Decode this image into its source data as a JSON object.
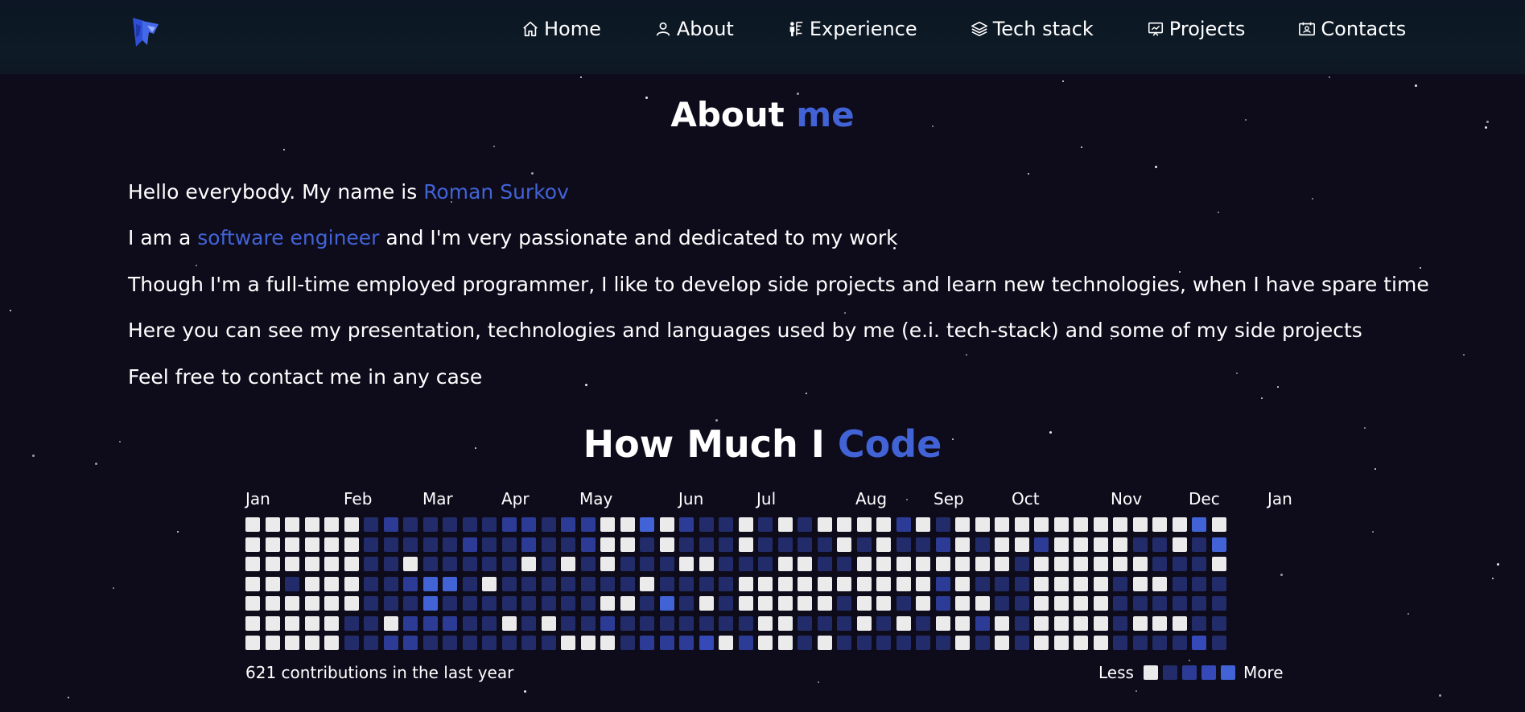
{
  "nav": {
    "items": [
      {
        "label": "Home",
        "icon": "home-icon"
      },
      {
        "label": "About",
        "icon": "user-icon"
      },
      {
        "label": "Experience",
        "icon": "presenter-icon"
      },
      {
        "label": "Tech stack",
        "icon": "layers-icon"
      },
      {
        "label": "Projects",
        "icon": "presentation-board-icon"
      },
      {
        "label": "Contacts",
        "icon": "contact-card-icon"
      }
    ]
  },
  "about": {
    "title_plain": "About ",
    "title_accent": "me",
    "line1_pre": "Hello everybody. My name is ",
    "line1_name": "Roman Surkov",
    "line2_pre": "I am a ",
    "line2_role": "software engineer",
    "line2_post": " and I'm very passionate and dedicated to my work",
    "line3": "Though I'm a full-time employed programmer, I like to develop side projects and learn new technologies, when I have spare time",
    "line4": "Here you can see my presentation, technologies and languages used by me (e.i. tech-stack) and some of my side projects",
    "line5": "Feel free to contact me in any case"
  },
  "code": {
    "title_plain": "How Much I ",
    "title_accent": "Code",
    "total_text": "621 contributions in the last year",
    "legend_less": "Less",
    "legend_more": "More",
    "months": [
      "Jan",
      "Feb",
      "Mar",
      "Apr",
      "May",
      "Jun",
      "Jul",
      "Aug",
      "Sep",
      "Oct",
      "Nov",
      "Dec",
      "Jan"
    ],
    "level_colors": [
      "#ebebeb",
      "#222c6a",
      "#2c3c96",
      "#3549b8",
      "#4263d6"
    ],
    "weeks": [
      [
        0,
        0,
        0,
        0,
        0,
        0,
        0
      ],
      [
        0,
        0,
        0,
        0,
        0,
        0,
        0
      ],
      [
        0,
        0,
        0,
        1,
        0,
        0,
        0
      ],
      [
        0,
        0,
        0,
        0,
        0,
        0,
        0
      ],
      [
        0,
        0,
        0,
        0,
        0,
        0,
        0
      ],
      [
        0,
        0,
        0,
        0,
        0,
        1,
        1
      ],
      [
        1,
        1,
        1,
        1,
        1,
        1,
        1
      ],
      [
        2,
        1,
        1,
        1,
        1,
        0,
        2
      ],
      [
        1,
        1,
        0,
        2,
        1,
        2,
        2
      ],
      [
        1,
        1,
        1,
        4,
        4,
        2,
        1
      ],
      [
        1,
        1,
        1,
        4,
        1,
        2,
        1
      ],
      [
        1,
        2,
        1,
        1,
        1,
        1,
        1
      ],
      [
        1,
        1,
        1,
        0,
        1,
        1,
        1
      ],
      [
        2,
        1,
        1,
        1,
        1,
        0,
        1
      ],
      [
        2,
        2,
        0,
        1,
        1,
        1,
        1
      ],
      [
        1,
        1,
        1,
        1,
        1,
        0,
        1
      ],
      [
        2,
        1,
        0,
        1,
        1,
        1,
        0
      ],
      [
        2,
        2,
        1,
        1,
        1,
        1,
        0
      ],
      [
        0,
        0,
        0,
        1,
        0,
        2,
        0
      ],
      [
        0,
        0,
        1,
        1,
        0,
        1,
        1
      ],
      [
        4,
        1,
        1,
        0,
        1,
        1,
        2
      ],
      [
        0,
        0,
        1,
        1,
        4,
        1,
        2
      ],
      [
        2,
        1,
        0,
        1,
        1,
        1,
        2
      ],
      [
        1,
        1,
        0,
        1,
        0,
        1,
        3
      ],
      [
        1,
        1,
        1,
        1,
        1,
        1,
        0
      ],
      [
        0,
        0,
        1,
        0,
        0,
        1,
        2
      ],
      [
        1,
        1,
        1,
        0,
        0,
        0,
        0
      ],
      [
        0,
        1,
        0,
        0,
        0,
        0,
        0
      ],
      [
        1,
        1,
        0,
        0,
        0,
        1,
        1
      ],
      [
        0,
        1,
        1,
        0,
        0,
        1,
        0
      ],
      [
        0,
        0,
        1,
        0,
        1,
        1,
        1
      ],
      [
        0,
        1,
        0,
        0,
        0,
        0,
        1
      ],
      [
        0,
        0,
        0,
        0,
        0,
        1,
        1
      ],
      [
        2,
        1,
        0,
        0,
        1,
        0,
        1
      ],
      [
        0,
        1,
        0,
        0,
        0,
        1,
        1
      ],
      [
        1,
        2,
        0,
        2,
        2,
        0,
        1
      ],
      [
        0,
        0,
        0,
        0,
        0,
        0,
        0
      ],
      [
        0,
        1,
        0,
        1,
        0,
        2,
        1
      ],
      [
        0,
        0,
        0,
        1,
        1,
        0,
        0
      ],
      [
        0,
        0,
        1,
        1,
        1,
        1,
        1
      ],
      [
        0,
        2,
        0,
        0,
        0,
        0,
        0
      ],
      [
        0,
        0,
        0,
        0,
        0,
        0,
        0
      ],
      [
        0,
        0,
        0,
        0,
        0,
        0,
        0
      ],
      [
        0,
        0,
        0,
        0,
        0,
        0,
        0
      ],
      [
        0,
        0,
        0,
        1,
        1,
        1,
        1
      ],
      [
        0,
        1,
        0,
        0,
        1,
        0,
        1
      ],
      [
        0,
        1,
        1,
        0,
        1,
        0,
        1
      ],
      [
        0,
        0,
        1,
        1,
        1,
        0,
        1
      ],
      [
        4,
        1,
        1,
        1,
        1,
        1,
        3
      ],
      [
        0,
        4,
        0,
        1,
        1,
        1,
        1
      ]
    ]
  }
}
